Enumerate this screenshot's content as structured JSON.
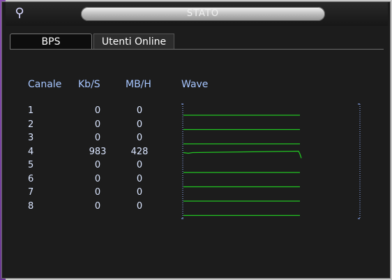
{
  "window": {
    "title": "STATO"
  },
  "tabs": [
    {
      "label": "BPS",
      "active": true
    },
    {
      "label": "Utenti Online",
      "active": false
    }
  ],
  "table": {
    "headers": {
      "channel": "Canale",
      "kbs": "Kb/S",
      "mbh": "MB/H",
      "wave": "Wave"
    },
    "rows": [
      {
        "channel": "1",
        "kbs": "0",
        "mbh": "0"
      },
      {
        "channel": "2",
        "kbs": "0",
        "mbh": "0"
      },
      {
        "channel": "3",
        "kbs": "0",
        "mbh": "0"
      },
      {
        "channel": "4",
        "kbs": "983",
        "mbh": "428"
      },
      {
        "channel": "5",
        "kbs": "0",
        "mbh": "0"
      },
      {
        "channel": "6",
        "kbs": "0",
        "mbh": "0"
      },
      {
        "channel": "7",
        "kbs": "0",
        "mbh": "0"
      },
      {
        "channel": "8",
        "kbs": "0",
        "mbh": "0"
      }
    ]
  },
  "colors": {
    "wave_line": "#22c322",
    "scale": "#8fb0ff",
    "header_text": "#a7c6ff"
  },
  "icons": {
    "logo": "camera-logo-icon"
  }
}
